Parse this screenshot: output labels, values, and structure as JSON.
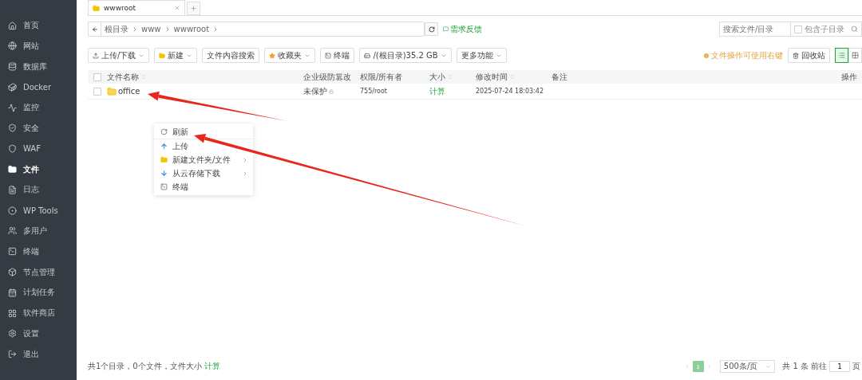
{
  "sidebar": {
    "items": [
      {
        "label": "首页",
        "selected": false
      },
      {
        "label": "网站",
        "selected": false
      },
      {
        "label": "数据库",
        "selected": false
      },
      {
        "label": "Docker",
        "selected": false
      },
      {
        "label": "监控",
        "selected": false
      },
      {
        "label": "安全",
        "selected": false
      },
      {
        "label": "WAF",
        "selected": false
      },
      {
        "label": "文件",
        "selected": true
      },
      {
        "label": "日志",
        "selected": false
      },
      {
        "label": "WP Tools",
        "selected": false
      },
      {
        "label": "多用户",
        "selected": false
      },
      {
        "label": "终端",
        "selected": false
      },
      {
        "label": "节点管理",
        "selected": false
      },
      {
        "label": "计划任务",
        "selected": false
      },
      {
        "label": "软件商店",
        "selected": false
      },
      {
        "label": "设置",
        "selected": false
      },
      {
        "label": "退出",
        "selected": false
      }
    ]
  },
  "tabs": [
    {
      "label": "wwwroot",
      "selected": true
    }
  ],
  "address_bar": {
    "breadcrumbs": [
      "根目录",
      "www",
      "wwwroot"
    ],
    "feedback": "需求反馈"
  },
  "search": {
    "placeholder": "搜索文件/目录",
    "include_subdirs": {
      "label": "包含子目录",
      "checked": false
    }
  },
  "toolbar": {
    "buttons": [
      {
        "label": "上传/下载",
        "kind": "upload",
        "dropdown": true
      },
      {
        "label": "新建",
        "kind": "new",
        "dropdown": true
      },
      {
        "label": "文件内容搜索",
        "kind": "plain",
        "dropdown": false
      },
      {
        "label": "收藏夹",
        "kind": "star",
        "dropdown": true
      },
      {
        "label": "终端",
        "kind": "terminal",
        "dropdown": false
      },
      {
        "label": "/(根目录)35.2 GB",
        "kind": "disk",
        "dropdown": true
      },
      {
        "label": "更多功能",
        "kind": "plain",
        "dropdown": true
      }
    ],
    "hint": "文件操作可使用右键",
    "recycle": "回收站",
    "views": [
      {
        "kind": "list",
        "selected": true
      },
      {
        "kind": "grid",
        "selected": false
      }
    ]
  },
  "table": {
    "select_all_checked": false,
    "columns": [
      "文件名称",
      "企业级防篡改",
      "权限/所有者",
      "大小",
      "修改时间",
      "备注",
      "操作"
    ],
    "rows": [
      {
        "name": "office",
        "protection": "未保护",
        "permission": "755/root",
        "size": "计算",
        "modified": "2025-07-24 18:03:42",
        "checked": false
      }
    ]
  },
  "context_menu": {
    "items": [
      {
        "label": "刷新",
        "kind": "refresh",
        "submenu": false
      },
      {
        "label": "上传",
        "kind": "upload",
        "submenu": false
      },
      {
        "label": "新建文件夹/文件",
        "kind": "new",
        "submenu": true
      },
      {
        "label": "从云存储下载",
        "kind": "download",
        "submenu": true
      },
      {
        "label": "终端",
        "kind": "terminal",
        "submenu": false
      }
    ]
  },
  "footer": {
    "summary": "共1个目录，0个文件，文件大小",
    "calc_link": "计算",
    "pagination": {
      "pages": [
        {
          "label": "1",
          "selected": true
        }
      ],
      "page_size": "500条/页",
      "total": "共 1 条",
      "goto": "前往",
      "goto_value": "1",
      "page_unit": "页"
    }
  }
}
